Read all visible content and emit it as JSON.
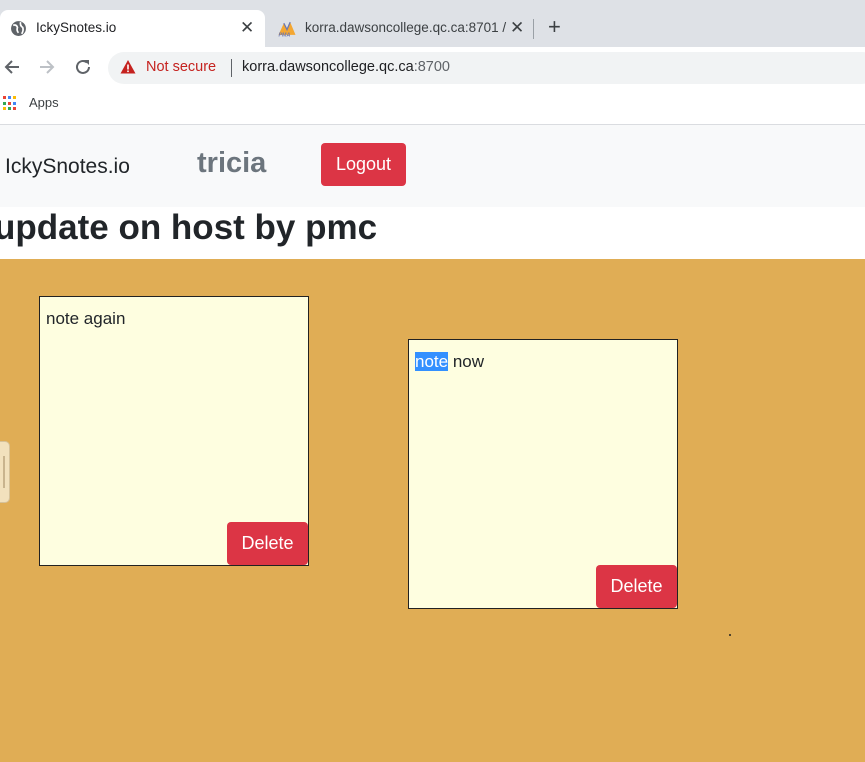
{
  "browser": {
    "tabs": [
      {
        "title": "IckySnotes.io",
        "active": true
      },
      {
        "title": "korra.dawsoncollege.qc.ca:8701 /",
        "active": false
      }
    ],
    "close_glyph": "✕",
    "new_tab_glyph": "+",
    "security_label": "Not secure",
    "url_host": "korra.dawsoncollege.qc.ca",
    "url_port": ":8700",
    "bookmarks": [
      {
        "label": "Apps"
      }
    ],
    "colors": {
      "warning": "#c5221f"
    }
  },
  "navbar": {
    "brand": "IckySnotes.io",
    "username": "tricia",
    "logout_label": "Logout"
  },
  "board": {
    "title": "update on host by pmc",
    "background": "#e0ad55",
    "notes": [
      {
        "text": "note again",
        "delete_label": "Delete"
      },
      {
        "text_selected": "note",
        "text_rest": " now",
        "delete_label": "Delete"
      }
    ]
  }
}
